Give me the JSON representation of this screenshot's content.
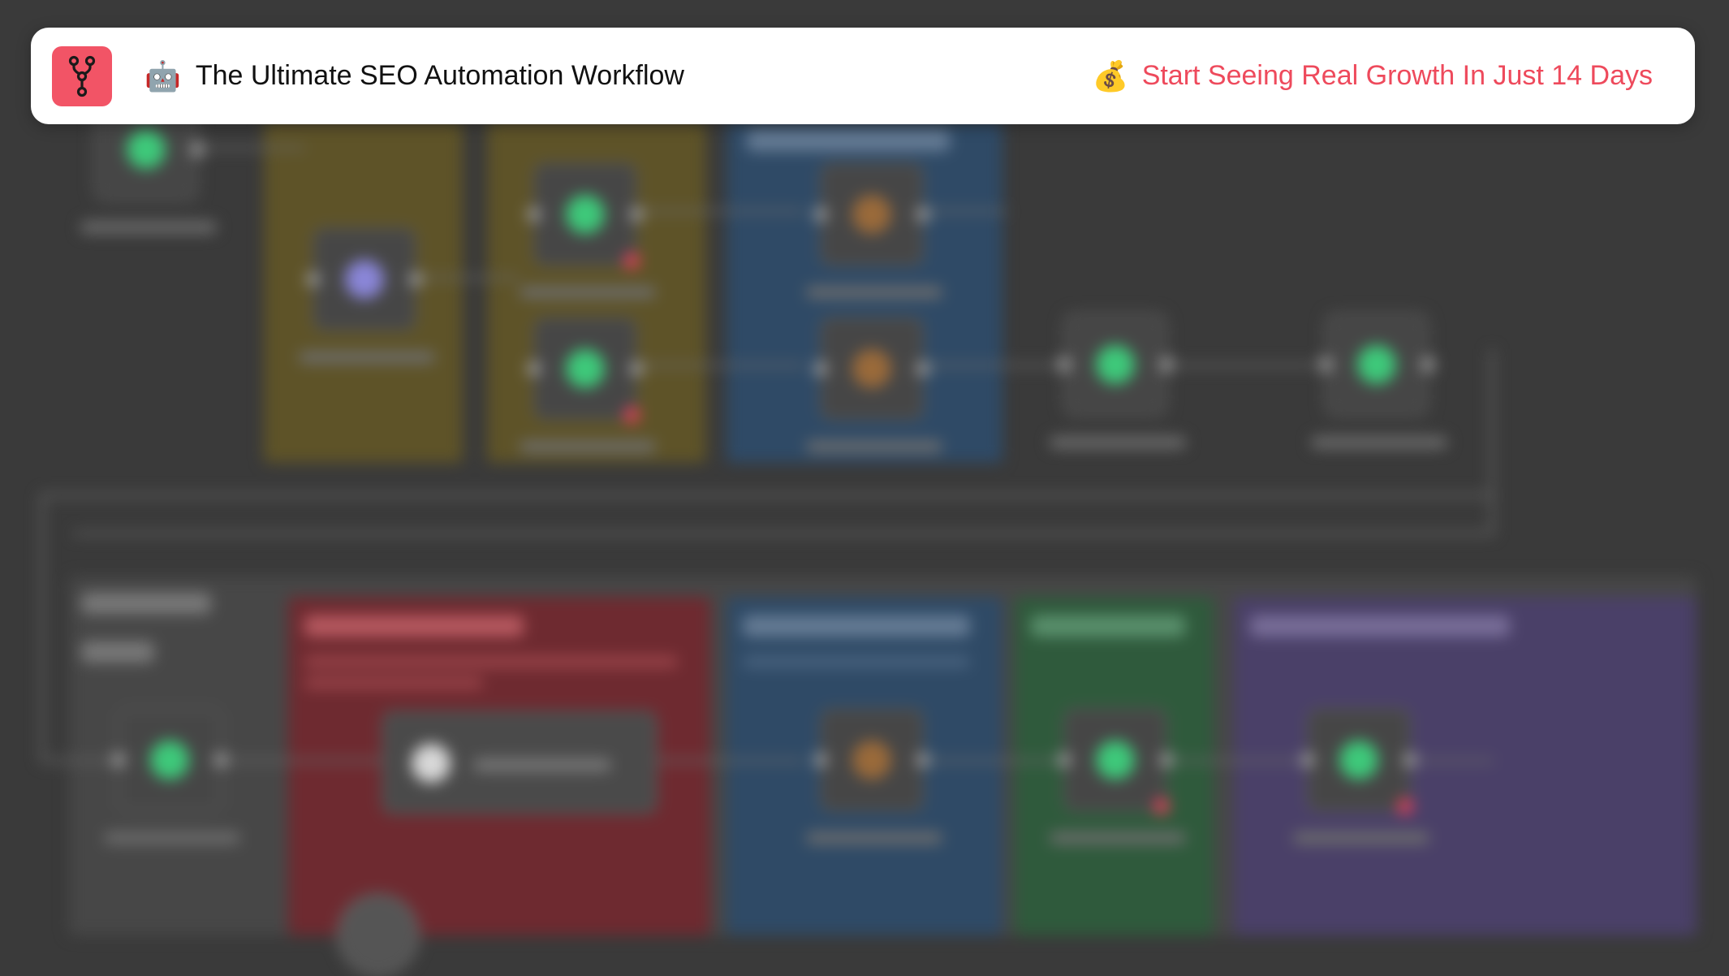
{
  "header": {
    "logo_icon": "workflow-branch-icon",
    "title_emoji": "🤖",
    "title_emoji_icon": "robot-icon",
    "title": "The Ultimate SEO Automation Workflow",
    "tagline_emoji": "💰",
    "tagline_emoji_icon": "money-bag-icon",
    "tagline": "Start Seeing Real Growth In Just 14 Days",
    "colors": {
      "logo_bg": "#f25466",
      "tagline": "#ee4a5c",
      "title": "#111111",
      "background": "#ffffff"
    }
  },
  "canvas": {
    "colors": {
      "background": "#3a3a3a",
      "zone_olive": "#5e5328",
      "zone_blue": "#2f4a66",
      "zone_red": "#6e2a30",
      "zone_green": "#2f5a3c",
      "zone_purple": "#4a4068",
      "node_green": "#3ec97a",
      "node_orange": "#9a6a3a"
    }
  }
}
